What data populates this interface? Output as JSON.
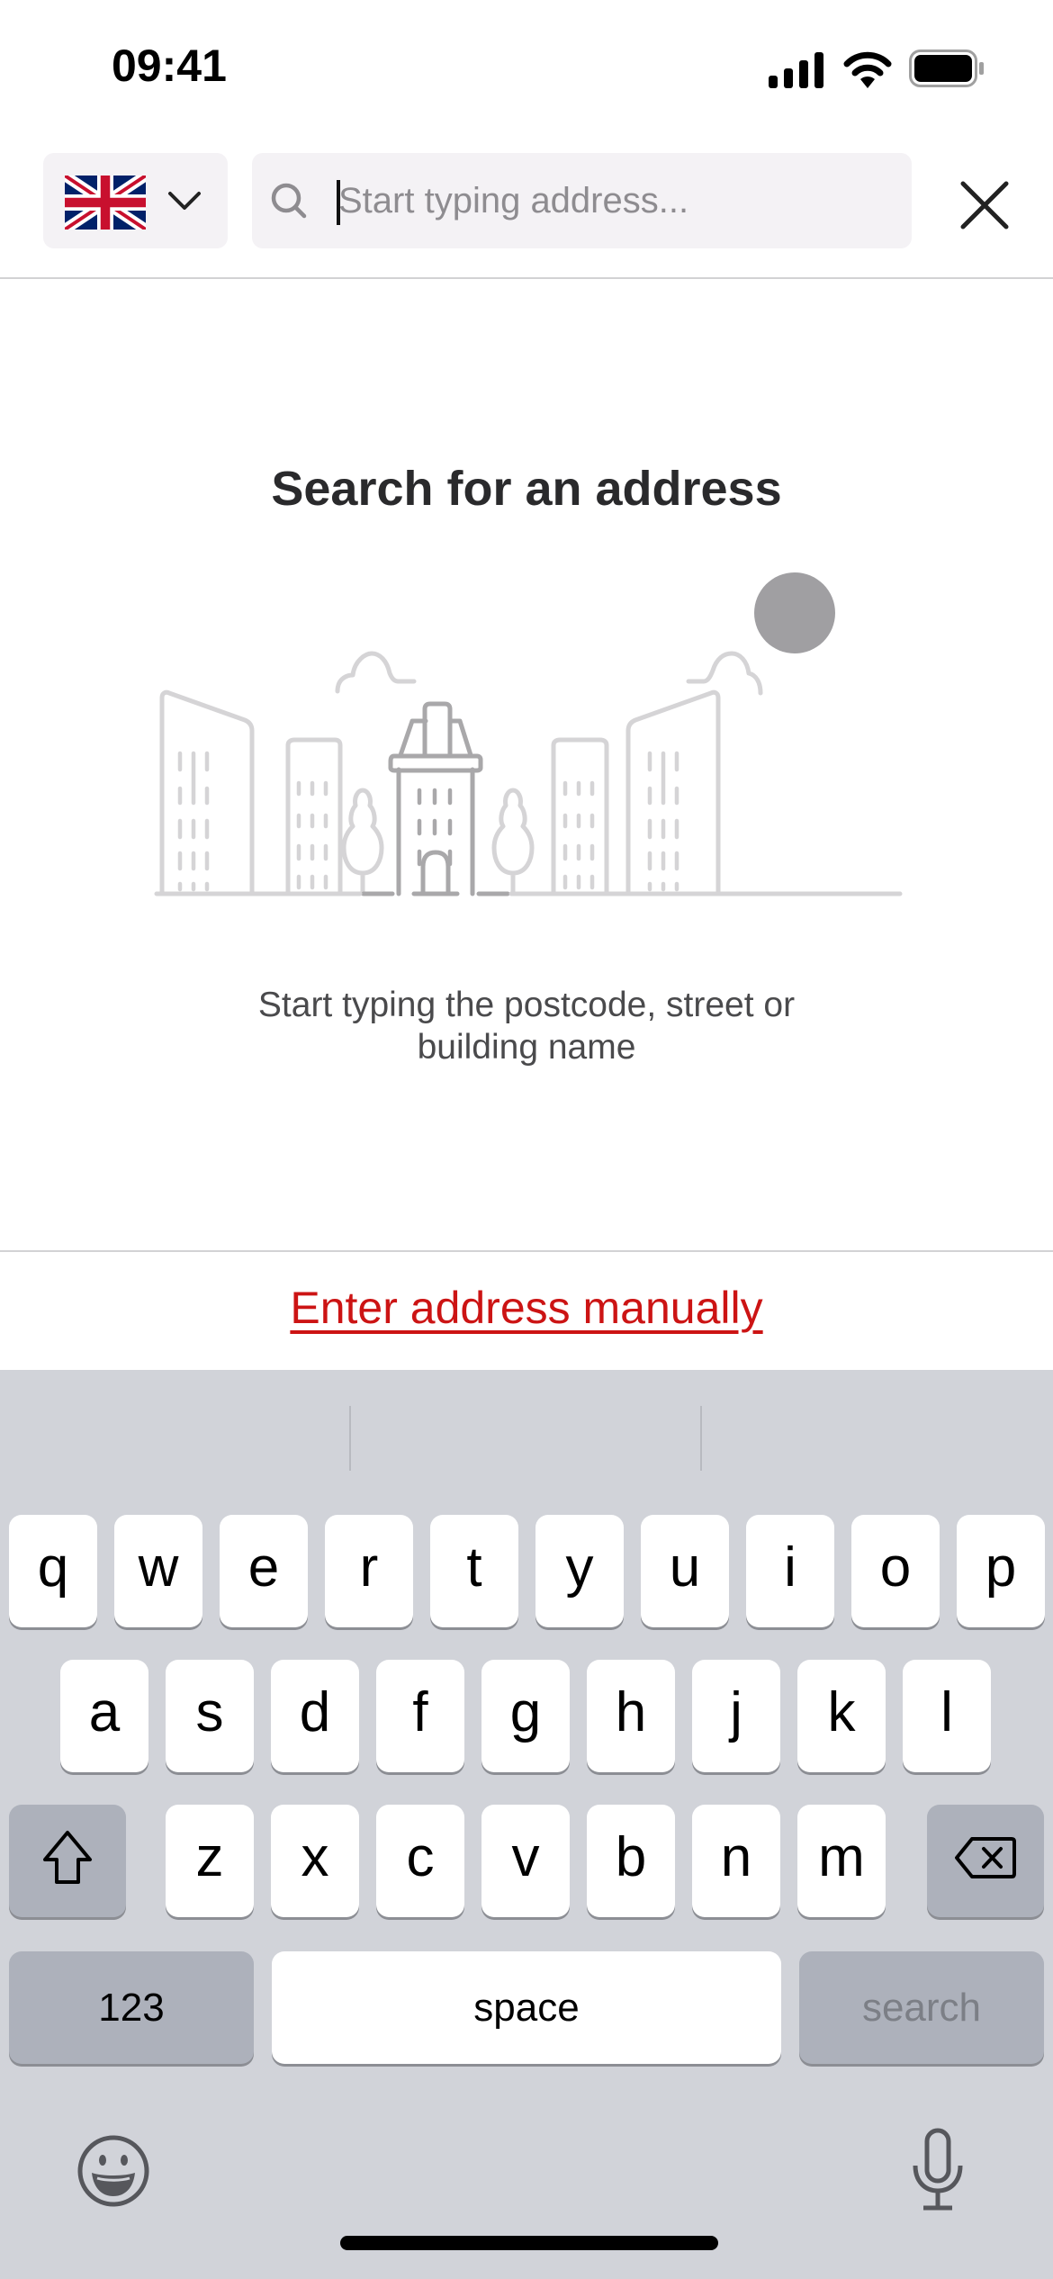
{
  "status_bar": {
    "time": "09:41",
    "icons": [
      "cellular-signal-icon",
      "wifi-icon",
      "battery-icon"
    ]
  },
  "header": {
    "country_selector": {
      "country": "United Kingdom",
      "flag_icon": "uk-flag-icon",
      "dropdown_icon": "chevron-down-icon"
    },
    "search": {
      "value": "",
      "placeholder": "Start typing address...",
      "icon": "search-icon"
    },
    "close_icon": "close-icon"
  },
  "content": {
    "title": "Search for an address",
    "illustration": "city-skyline-illustration",
    "subtitle_line1": "Start typing the postcode, street or",
    "subtitle_line2": "building name"
  },
  "footer": {
    "manual_link": "Enter address manually"
  },
  "colors": {
    "accent_red": "#cc1414",
    "field_bg": "#f4f2f5",
    "keyboard_bg": "#d1d3d9",
    "sun_gray": "#a09fa2"
  },
  "keyboard": {
    "row1": [
      "q",
      "w",
      "e",
      "r",
      "t",
      "y",
      "u",
      "i",
      "o",
      "p"
    ],
    "row2": [
      "a",
      "s",
      "d",
      "f",
      "g",
      "h",
      "j",
      "k",
      "l"
    ],
    "row3": [
      "z",
      "x",
      "c",
      "v",
      "b",
      "n",
      "m"
    ],
    "numbers_label": "123",
    "space_label": "space",
    "return_label": "search",
    "shift_icon": "shift-icon",
    "delete_icon": "backspace-icon",
    "emoji_icon": "emoji-icon",
    "mic_icon": "microphone-icon"
  }
}
